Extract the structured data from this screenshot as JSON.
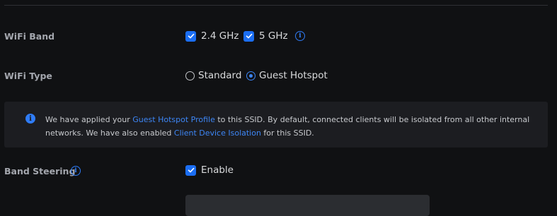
{
  "wifi_band": {
    "label": "WiFi Band",
    "options": [
      {
        "label": "2.4 GHz",
        "checked": true
      },
      {
        "label": "5 GHz",
        "checked": true
      }
    ]
  },
  "wifi_type": {
    "label": "WiFi Type",
    "options": [
      {
        "label": "Standard",
        "selected": false
      },
      {
        "label": "Guest Hotspot",
        "selected": true
      }
    ]
  },
  "notice": {
    "text_1": "We have applied your ",
    "link_1": "Guest Hotspot Profile",
    "text_2": " to this SSID. By default, connected clients will be isolated from all other internal networks. We have also enabled ",
    "link_2": "Client Device Isolation",
    "text_3": " for this SSID."
  },
  "band_steering": {
    "label": "Band Steering",
    "option_label": "Enable",
    "checked": true
  },
  "colors": {
    "accent": "#1b6ef3",
    "link": "#3d86f6",
    "background": "#101113",
    "panel": "#1c1d21"
  },
  "icons": {
    "check": "check-icon",
    "info": "info-icon"
  }
}
